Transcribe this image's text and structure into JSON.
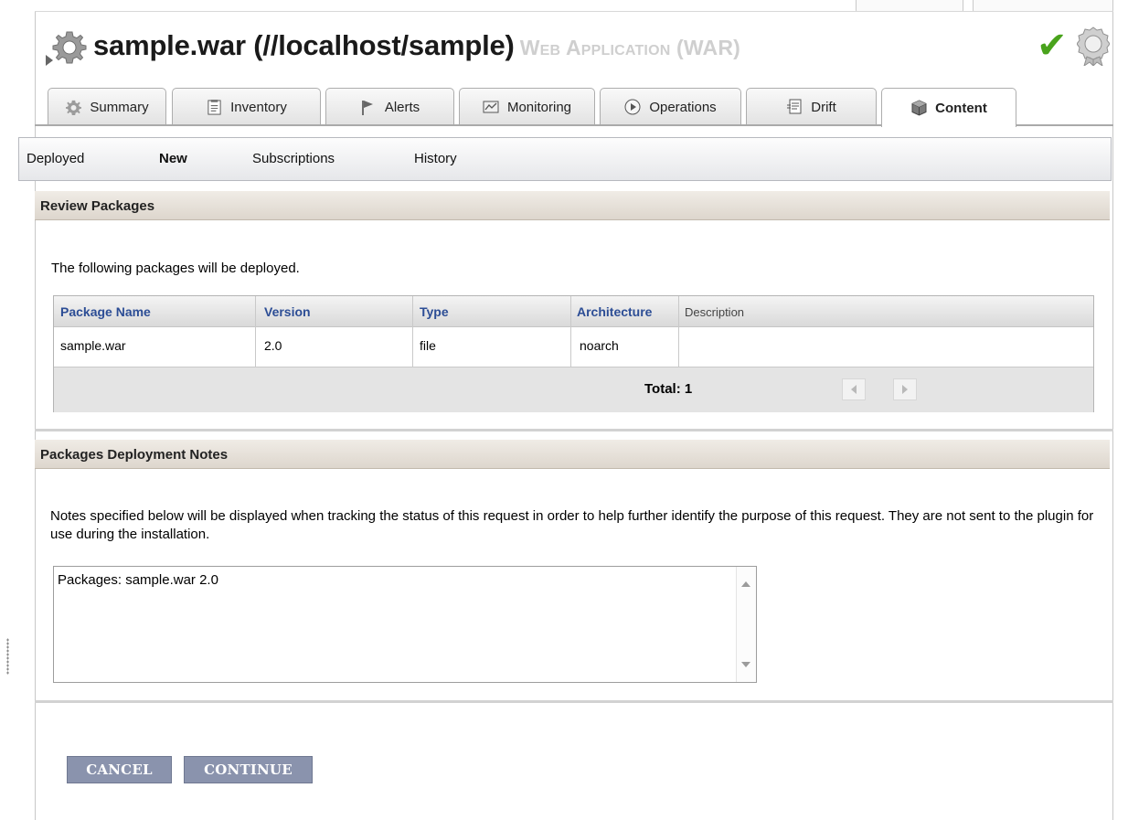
{
  "header": {
    "title": "sample.war (//localhost/sample)",
    "resource_type": "Web Application (WAR)",
    "status_icon": "check-icon",
    "availability_color": "#49a31c"
  },
  "tabs": [
    {
      "label": "Summary",
      "icon": "gear-icon",
      "active": false
    },
    {
      "label": "Inventory",
      "icon": "inventory-icon",
      "active": false
    },
    {
      "label": "Alerts",
      "icon": "flag-icon",
      "active": false
    },
    {
      "label": "Monitoring",
      "icon": "monitor-icon",
      "active": false
    },
    {
      "label": "Operations",
      "icon": "play-icon",
      "active": false
    },
    {
      "label": "Drift",
      "icon": "drift-icon",
      "active": false
    },
    {
      "label": "Content",
      "icon": "box-icon",
      "active": true
    }
  ],
  "subtabs": [
    {
      "label": "Deployed",
      "active": false
    },
    {
      "label": "New",
      "active": true
    },
    {
      "label": "Subscriptions",
      "active": false
    },
    {
      "label": "History",
      "active": false
    }
  ],
  "review": {
    "title": "Review Packages",
    "intro": "The following packages will be deployed.",
    "columns": [
      "Package Name",
      "Version",
      "Type",
      "Architecture",
      "Description"
    ],
    "rows": [
      [
        "sample.war",
        "2.0",
        "file",
        "noarch",
        ""
      ]
    ],
    "total_label": "Total: 1"
  },
  "notes": {
    "title": "Packages Deployment Notes",
    "description": "Notes specified below will be displayed when tracking the status of this request in order to help further identify the purpose of this request. They are not sent to the plugin for use during the installation.",
    "value": "Packages: sample.war 2.0"
  },
  "actions": {
    "cancel_label": "CANCEL",
    "continue_label": "CONTINUE",
    "button_color": "#8a93ad"
  }
}
